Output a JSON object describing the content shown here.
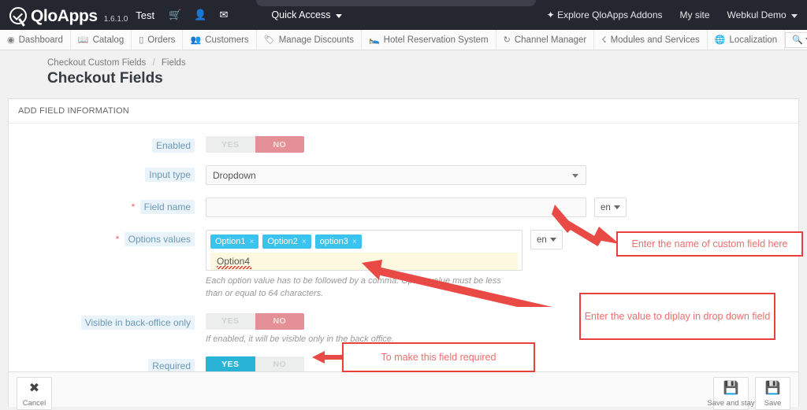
{
  "topbar": {
    "brand": "QloApps",
    "version": "1.6.1.0",
    "shop_name": "Test",
    "icons": [
      {
        "name": "cart-icon",
        "glyph": "Ὥ2"
      },
      {
        "name": "user-icon",
        "glyph": "\u0000"
      },
      {
        "name": "mail-icon",
        "glyph": "\u0000"
      }
    ],
    "quick_access": "Quick Access",
    "explore_addons": "Explore QloApps Addons",
    "my_site": "My site",
    "account": "Webkul Demo"
  },
  "menu": {
    "items": [
      {
        "label": "Dashboard",
        "icon": "speedometer-icon"
      },
      {
        "label": "Catalog",
        "icon": "book-icon"
      },
      {
        "label": "Orders",
        "icon": "credit-card-icon"
      },
      {
        "label": "Customers",
        "icon": "people-icon"
      },
      {
        "label": "Manage Discounts",
        "icon": "tag-icon"
      },
      {
        "label": "Hotel Reservation System",
        "icon": "bed-icon"
      },
      {
        "label": "Channel Manager",
        "icon": "refresh-icon"
      },
      {
        "label": "Modules and Services",
        "icon": "puzzle-icon"
      },
      {
        "label": "Localization",
        "icon": "globe-icon"
      }
    ],
    "search_placeholder": "Search",
    "search_value": ""
  },
  "page": {
    "breadcrumb_parent": "Checkout Custom Fields",
    "breadcrumb_sep": "/",
    "breadcrumb_current": "Fields",
    "title": "Checkout Fields"
  },
  "panel": {
    "heading": "ADD FIELD INFORMATION",
    "rows": {
      "enabled": {
        "label": "Enabled",
        "yes": "YES",
        "no": "NO",
        "value": "NO"
      },
      "input_type": {
        "label": "Input type",
        "value": "Dropdown"
      },
      "field_name": {
        "label": "Field name",
        "required_marker": "*",
        "value": "",
        "lang": "en"
      },
      "options_values": {
        "label": "Options values",
        "required_marker": "*",
        "tags": [
          "Option1",
          "Option2",
          "option3"
        ],
        "tag_remove": "×",
        "entry_value": "Option4",
        "lang": "en",
        "helper": "Each option value has to be followed by a comma.   Option value must be less than or equal to 64 characters."
      },
      "visible_back_office": {
        "label": "Visible in back-office only",
        "yes": "YES",
        "no": "NO",
        "value": "NO",
        "helper": "If enabled, it will be visible only in the back office."
      },
      "required": {
        "label": "Required",
        "yes": "YES",
        "no": "NO",
        "value": "YES"
      }
    }
  },
  "footer": {
    "cancel": {
      "label": "Cancel",
      "icon": "close-icon"
    },
    "save_and_stay": {
      "label": "Save and stay",
      "icon": "save-icon"
    },
    "save": {
      "label": "Save",
      "icon": "save-icon"
    }
  },
  "annotations": [
    {
      "name": "annotation-field-name",
      "text": "Enter the name of custom field here"
    },
    {
      "name": "annotation-options-values",
      "text": "Enter the value to diplay in drop down field"
    },
    {
      "name": "annotation-required",
      "text": "To make this field required"
    }
  ],
  "colors": {
    "accent_blue": "#29b3d7",
    "tag_blue": "#3bc3f0",
    "toggle_no": "#e58f96",
    "annotation_red": "#e8413c",
    "annotation_text": "#ef6f6c",
    "topbar_dark": "#242730"
  }
}
